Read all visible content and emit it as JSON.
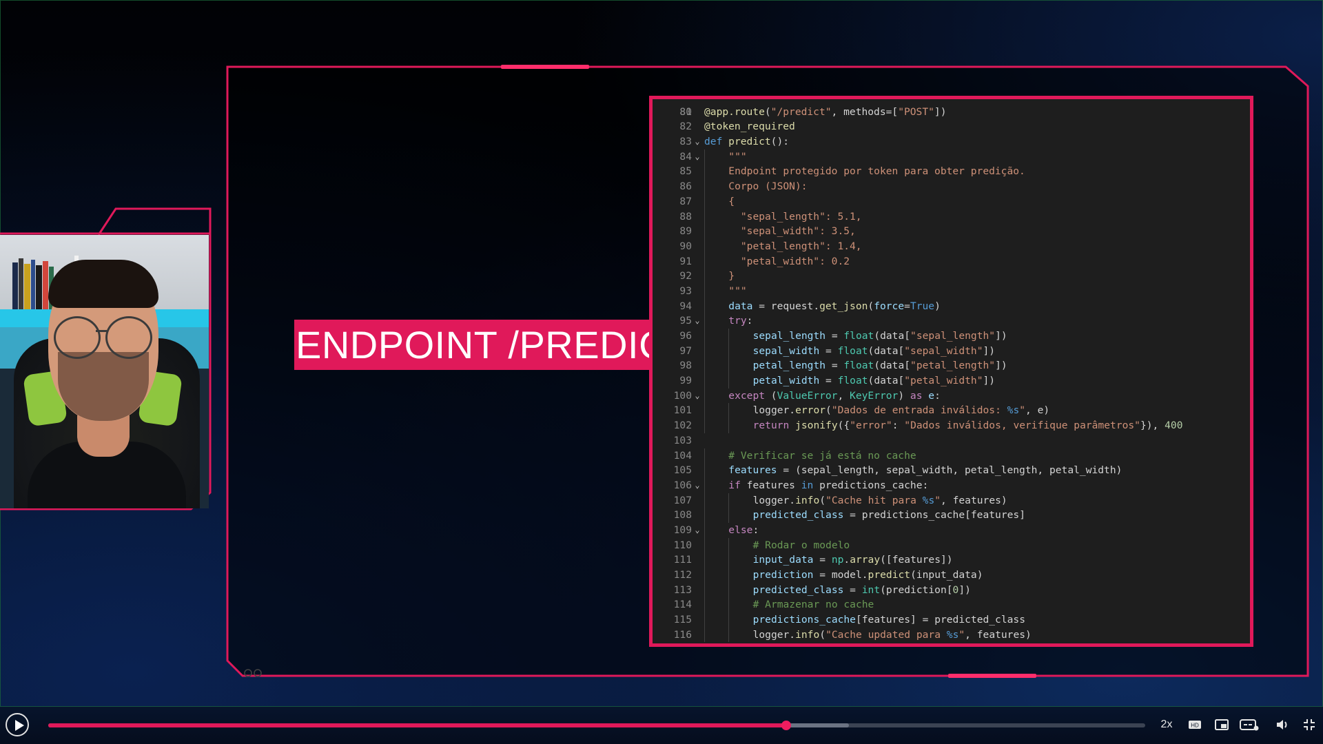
{
  "slide": {
    "banner_text": "ENDPOINT /PREDICT"
  },
  "code": {
    "top_partial_line_number": "80",
    "lines": [
      {
        "n": "81",
        "fold": "",
        "indent": 0,
        "html": "<span style=\"color:#dcdcaa\">@app.route</span>(<span style=\"color:#ce9178\">\"/predict\"</span>, methods=[<span style=\"color:#ce9178\">\"POST\"</span>])"
      },
      {
        "n": "82",
        "fold": "",
        "indent": 0,
        "html": "<span style=\"color:#dcdcaa\">@token_required</span>"
      },
      {
        "n": "83",
        "fold": "⌄",
        "indent": 0,
        "html": "<span style=\"color:#569cd6\">def</span> <span style=\"color:#dcdcaa\">predict</span>():"
      },
      {
        "n": "84",
        "fold": "⌄",
        "indent": 1,
        "html": "<span style=\"color:#ce9178\">\"\"\"</span>"
      },
      {
        "n": "85",
        "fold": "",
        "indent": 1,
        "html": "<span style=\"color:#ce9178\">Endpoint protegido por token para obter predição.</span>"
      },
      {
        "n": "86",
        "fold": "",
        "indent": 1,
        "html": "<span style=\"color:#ce9178\">Corpo (JSON):</span>"
      },
      {
        "n": "87",
        "fold": "",
        "indent": 1,
        "html": "<span style=\"color:#ce9178\">{</span>"
      },
      {
        "n": "88",
        "fold": "",
        "indent": 1,
        "html": "<span style=\"color:#ce9178\">  \"sepal_length\": 5.1,</span>"
      },
      {
        "n": "89",
        "fold": "",
        "indent": 1,
        "html": "<span style=\"color:#ce9178\">  \"sepal_width\": 3.5,</span>"
      },
      {
        "n": "90",
        "fold": "",
        "indent": 1,
        "html": "<span style=\"color:#ce9178\">  \"petal_length\": 1.4,</span>"
      },
      {
        "n": "91",
        "fold": "",
        "indent": 1,
        "html": "<span style=\"color:#ce9178\">  \"petal_width\": 0.2</span>"
      },
      {
        "n": "92",
        "fold": "",
        "indent": 1,
        "html": "<span style=\"color:#ce9178\">}</span>"
      },
      {
        "n": "93",
        "fold": "",
        "indent": 1,
        "html": "<span style=\"color:#ce9178\">\"\"\"</span>"
      },
      {
        "n": "94",
        "fold": "",
        "indent": 1,
        "html": "<span style=\"color:#9cdcfe\">data</span> = request.<span style=\"color:#dcdcaa\">get_json</span>(<span style=\"color:#9cdcfe\">force</span>=<span style=\"color:#569cd6\">True</span>)"
      },
      {
        "n": "95",
        "fold": "⌄",
        "indent": 1,
        "html": "<span style=\"color:#c586c0\">try</span>:"
      },
      {
        "n": "96",
        "fold": "",
        "indent": 2,
        "html": "<span style=\"color:#9cdcfe\">sepal_length</span> = <span style=\"color:#4ec9b0\">float</span>(data[<span style=\"color:#ce9178\">\"sepal_length\"</span>])"
      },
      {
        "n": "97",
        "fold": "",
        "indent": 2,
        "html": "<span style=\"color:#9cdcfe\">sepal_width</span> = <span style=\"color:#4ec9b0\">float</span>(data[<span style=\"color:#ce9178\">\"sepal_width\"</span>])"
      },
      {
        "n": "98",
        "fold": "",
        "indent": 2,
        "html": "<span style=\"color:#9cdcfe\">petal_length</span> = <span style=\"color:#4ec9b0\">float</span>(data[<span style=\"color:#ce9178\">\"petal_length\"</span>])"
      },
      {
        "n": "99",
        "fold": "",
        "indent": 2,
        "html": "<span style=\"color:#9cdcfe\">petal_width</span> = <span style=\"color:#4ec9b0\">float</span>(data[<span style=\"color:#ce9178\">\"petal_width\"</span>])"
      },
      {
        "n": "100",
        "fold": "⌄",
        "indent": 1,
        "html": "<span style=\"color:#c586c0\">except</span> (<span style=\"color:#4ec9b0\">ValueError</span>, <span style=\"color:#4ec9b0\">KeyError</span>) <span style=\"color:#c586c0\">as</span> <span style=\"color:#9cdcfe\">e</span>:"
      },
      {
        "n": "101",
        "fold": "",
        "indent": 2,
        "html": "logger.<span style=\"color:#dcdcaa\">error</span>(<span style=\"color:#ce9178\">\"Dados de entrada inválidos: </span><span style=\"color:#569cd6\">%s</span><span style=\"color:#ce9178\">\"</span>, e)"
      },
      {
        "n": "102",
        "fold": "",
        "indent": 2,
        "html": "<span style=\"color:#c586c0\">return</span> <span style=\"color:#dcdcaa\">jsonify</span>({<span style=\"color:#ce9178\">\"error\"</span>: <span style=\"color:#ce9178\">\"Dados inválidos, verifique parâmetros\"</span>}), <span style=\"color:#b5cea8\">400</span>"
      },
      {
        "n": "103",
        "fold": "",
        "indent": 0,
        "html": ""
      },
      {
        "n": "104",
        "fold": "",
        "indent": 1,
        "html": "<span style=\"color:#6a9955\"># Verificar se já está no cache</span>"
      },
      {
        "n": "105",
        "fold": "",
        "indent": 1,
        "html": "<span style=\"color:#9cdcfe\">features</span> = (sepal_length, sepal_width, petal_length, petal_width)"
      },
      {
        "n": "106",
        "fold": "⌄",
        "indent": 1,
        "html": "<span style=\"color:#c586c0\">if</span> features <span style=\"color:#569cd6\">in</span> predictions_cache:"
      },
      {
        "n": "107",
        "fold": "",
        "indent": 2,
        "html": "logger.<span style=\"color:#dcdcaa\">info</span>(<span style=\"color:#ce9178\">\"Cache hit para </span><span style=\"color:#569cd6\">%s</span><span style=\"color:#ce9178\">\"</span>, features)"
      },
      {
        "n": "108",
        "fold": "",
        "indent": 2,
        "html": "<span style=\"color:#9cdcfe\">predicted_class</span> = predictions_cache[features]"
      },
      {
        "n": "109",
        "fold": "⌄",
        "indent": 1,
        "html": "<span style=\"color:#c586c0\">else</span>:"
      },
      {
        "n": "110",
        "fold": "",
        "indent": 2,
        "html": "<span style=\"color:#6a9955\"># Rodar o modelo</span>"
      },
      {
        "n": "111",
        "fold": "",
        "indent": 2,
        "html": "<span style=\"color:#9cdcfe\">input_data</span> = <span style=\"color:#4ec9b0\">np</span>.<span style=\"color:#dcdcaa\">array</span>([features])"
      },
      {
        "n": "112",
        "fold": "",
        "indent": 2,
        "html": "<span style=\"color:#9cdcfe\">prediction</span> = model.<span style=\"color:#dcdcaa\">predict</span>(input_data)"
      },
      {
        "n": "113",
        "fold": "",
        "indent": 2,
        "html": "<span style=\"color:#9cdcfe\">predicted_class</span> = <span style=\"color:#4ec9b0\">int</span>(prediction[<span style=\"color:#b5cea8\">0</span>])"
      },
      {
        "n": "114",
        "fold": "",
        "indent": 2,
        "html": "<span style=\"color:#6a9955\"># Armazenar no cache</span>"
      },
      {
        "n": "115",
        "fold": "",
        "indent": 2,
        "html": "<span style=\"color:#9cdcfe\">predictions_cache</span>[features] = predicted_class"
      },
      {
        "n": "116",
        "fold": "",
        "indent": 2,
        "html": "logger.<span style=\"color:#dcdcaa\">info</span>(<span style=\"color:#ce9178\">\"Cache updated para </span><span style=\"color:#569cd6\">%s</span><span style=\"color:#ce9178\">\"</span>, features)"
      }
    ]
  },
  "player": {
    "progress_fraction": 0.673,
    "buffered_fraction": 0.73,
    "speed_label": "2x",
    "hd_label": "HD",
    "accent_color": "#e0195a"
  },
  "icons": {
    "play": "play-icon",
    "hd": "hd-icon",
    "pip": "picture-in-picture-icon",
    "captions": "captions-icon",
    "volume": "volume-icon",
    "fullscreen": "fullscreen-icon"
  }
}
